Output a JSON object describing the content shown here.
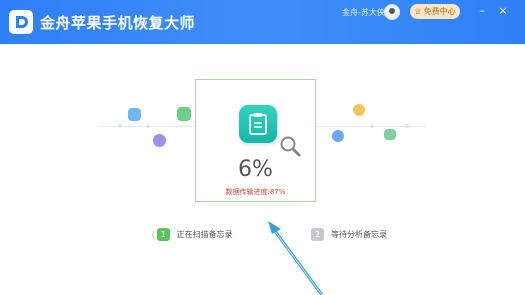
{
  "app": {
    "title": "金舟苹果手机恢复大师",
    "username": "金舟-苏大侠",
    "member_label": "免费中心",
    "minimize": "–",
    "close": "×"
  },
  "progress": {
    "percent": "6%",
    "percent_value": 0.06,
    "transfer_status": "数据传输进度:87%"
  },
  "steps": [
    {
      "prefix": "(",
      "number": "1",
      "label": "正在扫描备忘录",
      "state": "active",
      "color": "#5cc35a"
    },
    {
      "prefix": "",
      "number": "2",
      "label": "等待分析备忘录",
      "state": "pending",
      "color": "#c5c8cc"
    }
  ],
  "colors": {
    "titlebar": "#3a8af7",
    "card_border": "#a8d8a0",
    "accent_teal": "#1fc4b2",
    "status_red": "#e0443a",
    "arrow": "#3aa0d8"
  },
  "icons": {
    "app_logo": "app-logo-icon",
    "member": "crown-icon",
    "card": "clipboard-icon",
    "magnifier": "magnifier-icon"
  }
}
